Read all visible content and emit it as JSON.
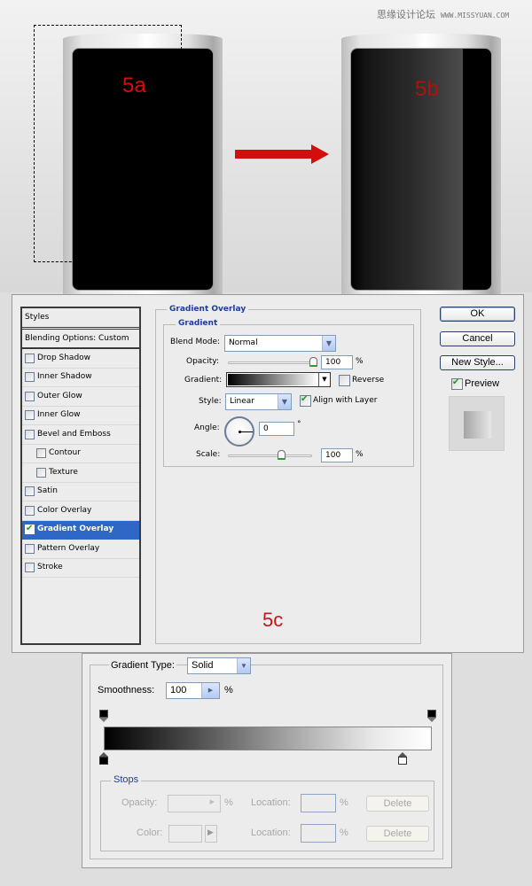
{
  "watermark": {
    "site_name": "思缘设计论坛",
    "url": "WWW.MISSYUAN.COM"
  },
  "illustration": {
    "label_a": "5a",
    "label_b": "5b",
    "arrow_color": "#d40d0d"
  },
  "dialog": {
    "styles_header": "Styles",
    "blending_options": "Blending Options: Custom",
    "style_items": [
      {
        "label": "Drop Shadow",
        "checked": false
      },
      {
        "label": "Inner Shadow",
        "checked": false
      },
      {
        "label": "Outer Glow",
        "checked": false
      },
      {
        "label": "Inner Glow",
        "checked": false
      },
      {
        "label": "Bevel and Emboss",
        "checked": false
      },
      {
        "label": "Contour",
        "checked": false
      },
      {
        "label": "Texture",
        "checked": false
      },
      {
        "label": "Satin",
        "checked": false
      },
      {
        "label": "Color Overlay",
        "checked": false
      },
      {
        "label": "Gradient Overlay",
        "checked": true,
        "selected": true
      },
      {
        "label": "Pattern Overlay",
        "checked": false
      },
      {
        "label": "Stroke",
        "checked": false
      }
    ],
    "panel_title": "Gradient Overlay",
    "group_title": "Gradient",
    "blend_mode": {
      "label": "Blend Mode:",
      "value": "Normal"
    },
    "opacity": {
      "label": "Opacity:",
      "value": "100",
      "unit": "%",
      "percent": 100
    },
    "gradient": {
      "label": "Gradient:",
      "from_color": "#000000",
      "to_color": "#ffffff"
    },
    "reverse": {
      "label": "Reverse",
      "checked": false
    },
    "style": {
      "label": "Style:",
      "value": "Linear"
    },
    "align_with_layer": {
      "label": "Align with Layer",
      "checked": true
    },
    "angle": {
      "label": "Angle:",
      "value": "0",
      "unit": "°"
    },
    "scale": {
      "label": "Scale:",
      "value": "100",
      "unit": "%",
      "percent": 100
    },
    "buttons": {
      "ok": "OK",
      "cancel": "Cancel",
      "new_style": "New Style..."
    },
    "preview": {
      "label": "Preview",
      "checked": true
    },
    "annotation": "5c",
    "accent_color": "#2f67c7",
    "title_color": "#1b3e9a"
  },
  "gradient_editor": {
    "gradient_type": {
      "label": "Gradient Type:",
      "value": "Solid"
    },
    "smoothness": {
      "label": "Smoothness:",
      "value": "100",
      "unit": "%"
    },
    "opacity_stops": [
      {
        "location_percent": 0,
        "color": "#000000"
      },
      {
        "location_percent": 100,
        "color": "#000000"
      }
    ],
    "color_stops": [
      {
        "location_percent": 0,
        "color": "#000000"
      },
      {
        "location_percent": 91,
        "color": "#ffffff"
      }
    ],
    "stops": {
      "title": "Stops",
      "opacity_label": "Opacity:",
      "opacity_unit": "%",
      "color_label": "Color:",
      "location_label": "Location:",
      "location_unit": "%",
      "delete_label": "Delete"
    }
  }
}
